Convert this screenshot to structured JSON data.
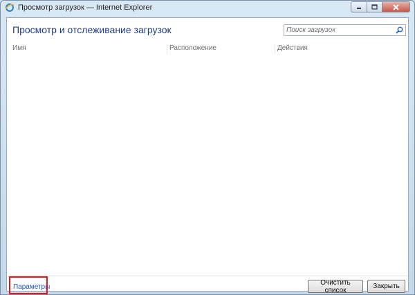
{
  "window": {
    "title": "Просмотр загрузок — Internet Explorer",
    "icons": {
      "app": "ie-icon",
      "minimize": "minimize-icon",
      "maximize": "maximize-icon",
      "close": "close-icon"
    }
  },
  "main": {
    "heading": "Просмотр и отслеживание загрузок",
    "search": {
      "placeholder": "Поиск загрузок",
      "icon": "search-icon"
    },
    "columns": [
      "Имя",
      "Расположение",
      "Действия"
    ],
    "items": []
  },
  "footer": {
    "settings_link": "Параметры",
    "clear_button": "Очистить список",
    "close_button": "Закрыть"
  },
  "colors": {
    "heading": "#1f3e88",
    "link": "#1a55b8",
    "highlight": "#e1181f"
  }
}
